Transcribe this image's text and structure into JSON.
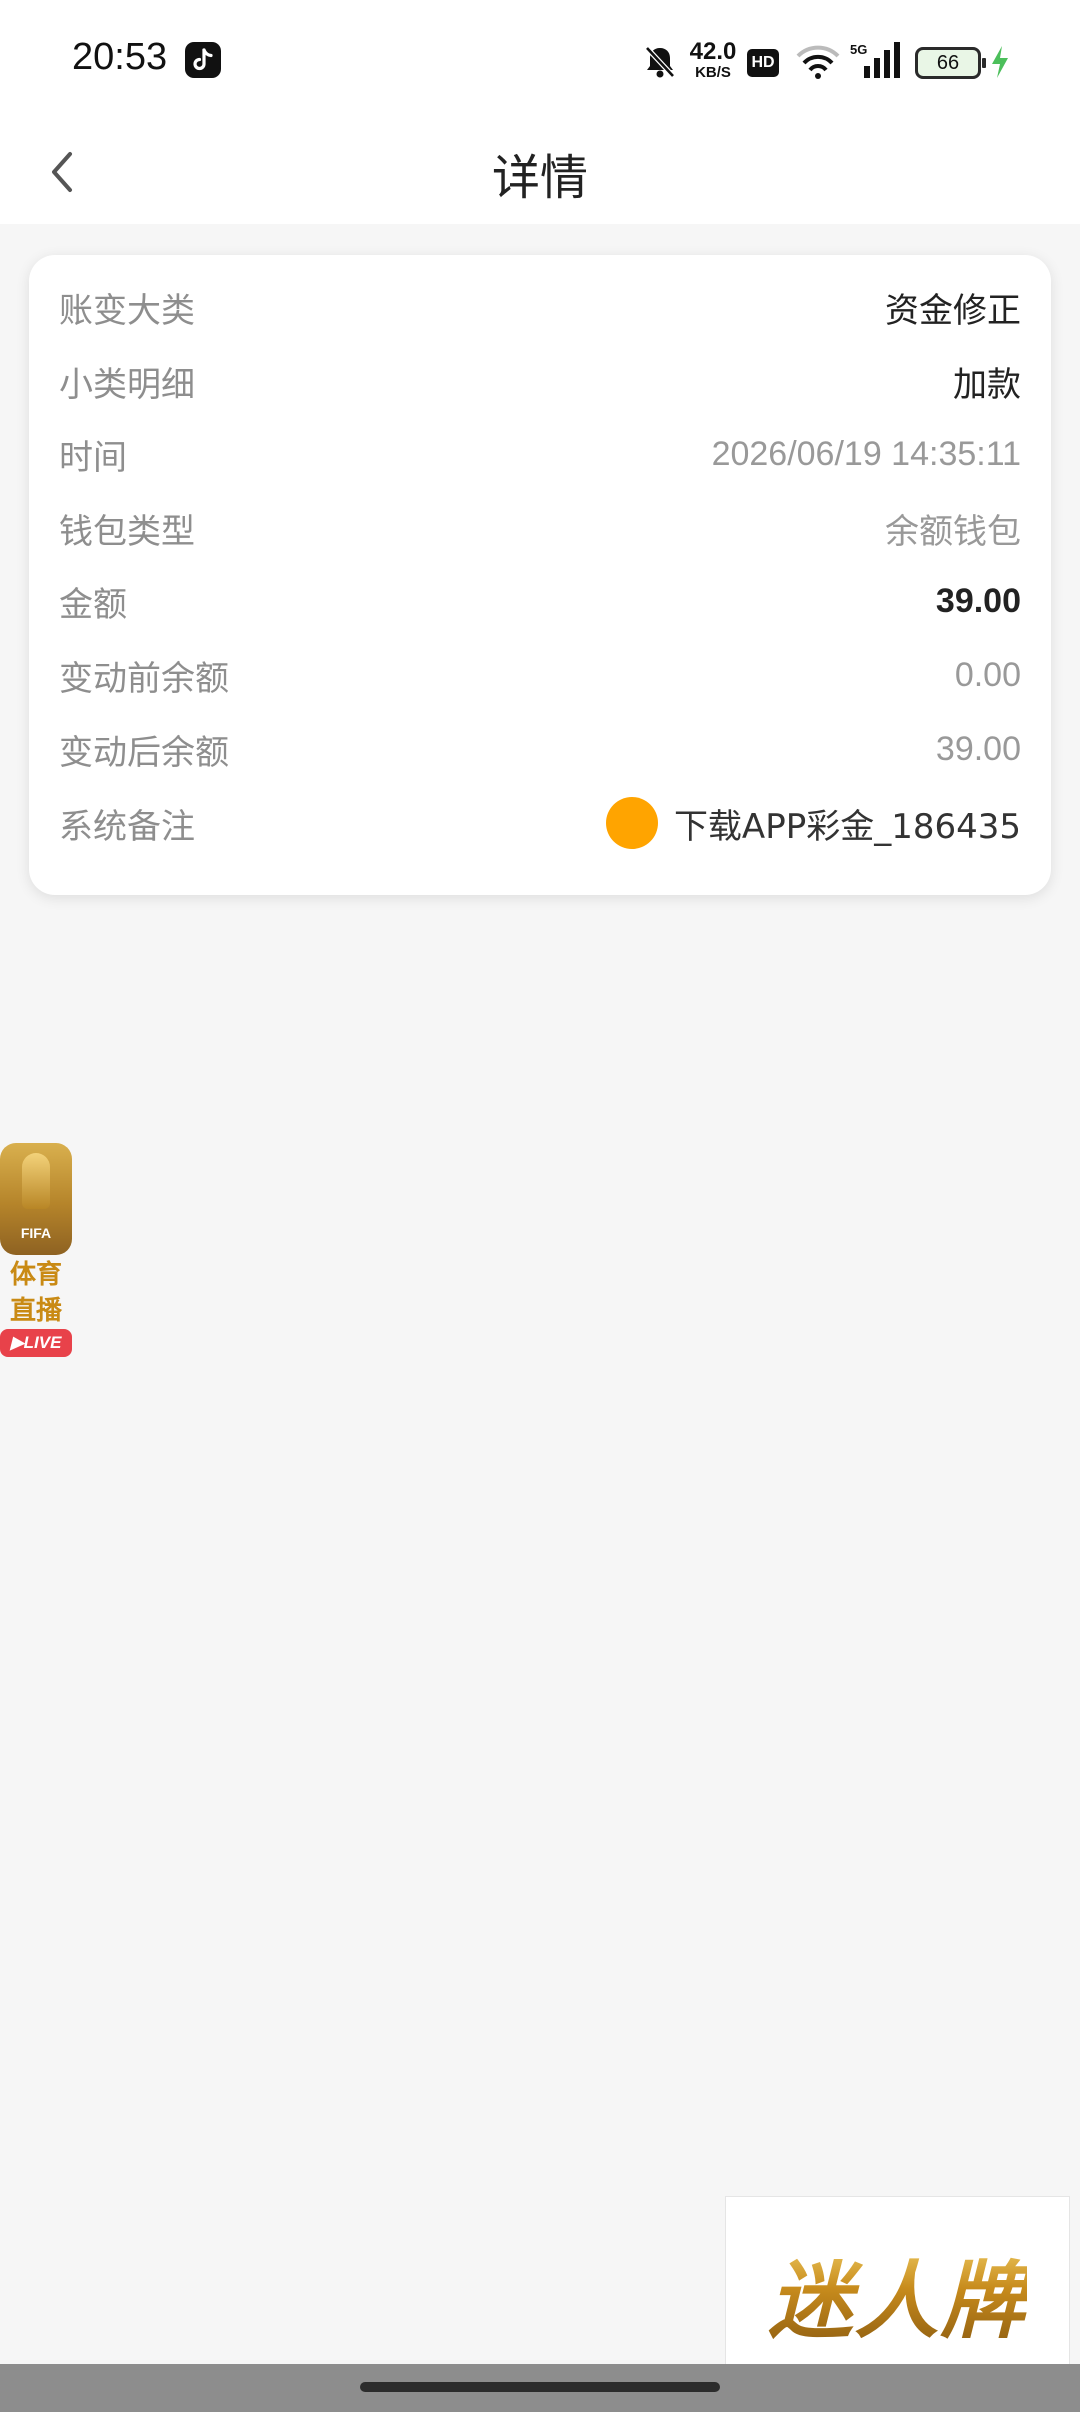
{
  "status_bar": {
    "time": "20:53",
    "net_speed_value": "42.0",
    "net_speed_unit": "KB/S",
    "hd_badge": "HD",
    "network_type": "5G",
    "battery_level": "66"
  },
  "nav": {
    "title": "详情"
  },
  "detail": {
    "rows": [
      {
        "label": "账变大类",
        "value": "资金修正"
      },
      {
        "label": "小类明细",
        "value": "加款"
      },
      {
        "label": "时间",
        "value": "2026/06/19 14:35:11"
      },
      {
        "label": "钱包类型",
        "value": "余额钱包"
      },
      {
        "label": "金额",
        "value": "39.00"
      },
      {
        "label": "变动前余额",
        "value": "0.00"
      },
      {
        "label": "变动后余额",
        "value": "39.00"
      },
      {
        "label": "系统备注",
        "value": "下载APP彩金_186435"
      }
    ]
  },
  "float_live": {
    "badge_text": "FIFA",
    "line1": "体育",
    "line2": "直播",
    "pill": "LIVE"
  },
  "brand_ad": {
    "text": "迷人牌"
  },
  "colors": {
    "accent_orange": "#ffa400",
    "page_bg": "#f6f6f6",
    "card_bg": "#ffffff"
  }
}
